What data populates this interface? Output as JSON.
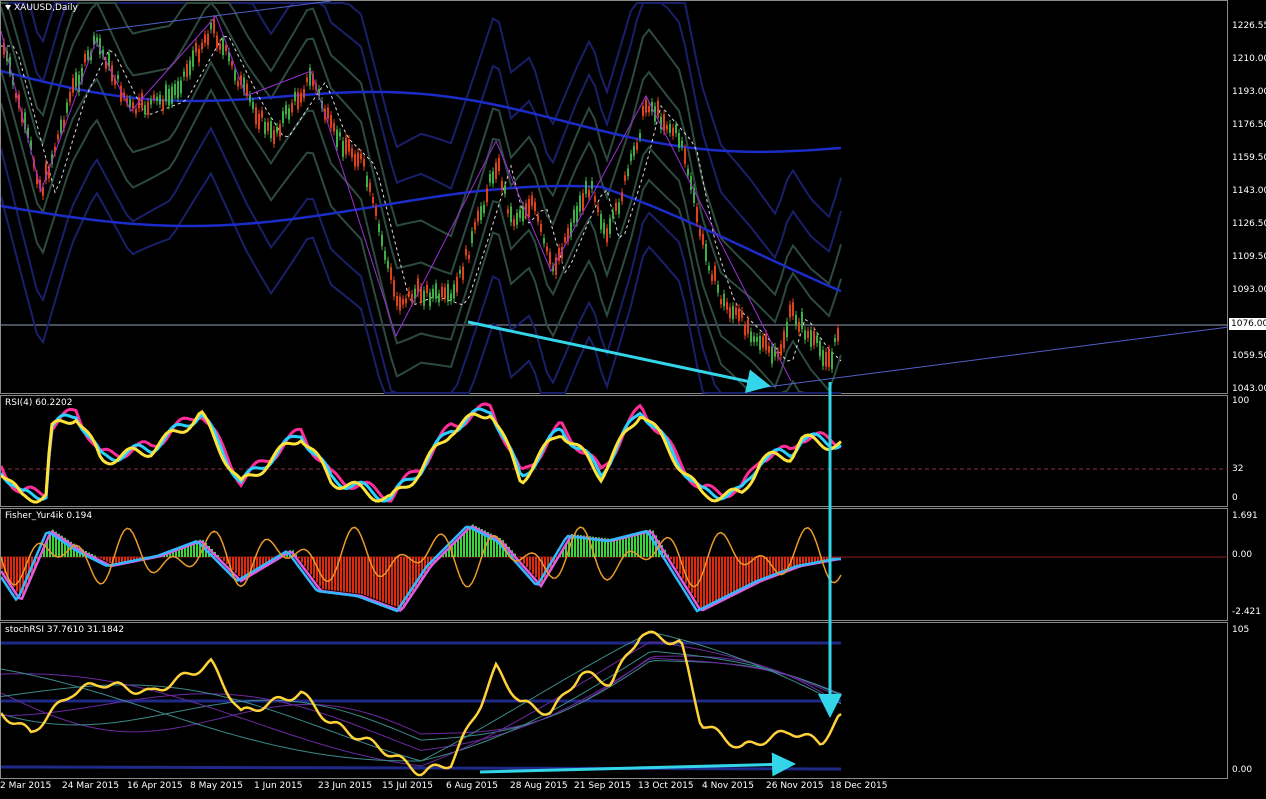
{
  "window": {
    "title": "XAUUSD,Daily"
  },
  "main": {
    "price_ticks": [
      "1226.55",
      "1210.00",
      "1193.00",
      "1176.50",
      "1159.50",
      "1143.00",
      "1126.50",
      "1109.50",
      "1093.00",
      "1076.00",
      "1059.50",
      "1043.00"
    ],
    "current_price": "1076.00",
    "colors": {
      "bull": "#3cb043",
      "bear": "#e0401a",
      "bands": "#2d4a3f",
      "ma_blue": "#1c2cc8",
      "arrow": "#33d6e8"
    }
  },
  "rsi": {
    "label": "RSI(4) 60.2202",
    "ticks": [
      "100",
      "32",
      "0"
    ]
  },
  "fisher": {
    "label": "Fisher_Yur4ik 0.194",
    "ticks": [
      "1.691",
      "0.00",
      "-2.421"
    ]
  },
  "stoch": {
    "label": "stochRSI 37.7610 31.1842",
    "ticks": [
      "105",
      "0.00"
    ]
  },
  "xaxis": [
    "2 Mar 2015",
    "24 Mar 2015",
    "16 Apr 2015",
    "8 May 2015",
    "1 Jun 2015",
    "23 Jun 2015",
    "15 Jul 2015",
    "6 Aug 2015",
    "28 Aug 2015",
    "21 Sep 2015",
    "13 Oct 2015",
    "4 Nov 2015",
    "26 Nov 2015",
    "18 Dec 2015"
  ]
}
